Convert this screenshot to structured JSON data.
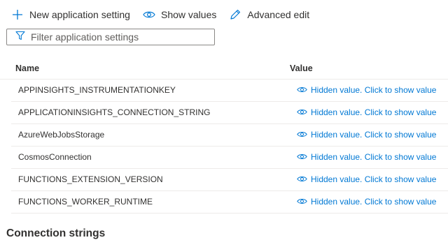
{
  "toolbar": {
    "new_label": "New application setting",
    "show_values_label": "Show values",
    "advanced_edit_label": "Advanced edit"
  },
  "filter": {
    "placeholder": "Filter application settings",
    "value": ""
  },
  "table": {
    "headers": {
      "name": "Name",
      "value": "Value"
    },
    "rows": [
      {
        "name": "APPINSIGHTS_INSTRUMENTATIONKEY",
        "value": "Hidden value. Click to show value"
      },
      {
        "name": "APPLICATIONINSIGHTS_CONNECTION_STRING",
        "value": "Hidden value. Click to show value"
      },
      {
        "name": "AzureWebJobsStorage",
        "value": "Hidden value. Click to show value"
      },
      {
        "name": "CosmosConnection",
        "value": "Hidden value. Click to show value"
      },
      {
        "name": "FUNCTIONS_EXTENSION_VERSION",
        "value": "Hidden value. Click to show value"
      },
      {
        "name": "FUNCTIONS_WORKER_RUNTIME",
        "value": "Hidden value. Click to show value"
      }
    ]
  },
  "section": {
    "connection_strings_title": "Connection strings"
  },
  "icons": {
    "new": "plus-icon",
    "show_values": "eye-icon",
    "advanced_edit": "pencil-icon",
    "filter": "funnel-icon",
    "row_value": "eye-icon"
  },
  "colors": {
    "accent": "#0078d4",
    "text": "#323130",
    "border": "#8a8886",
    "divider": "#edebe9"
  }
}
